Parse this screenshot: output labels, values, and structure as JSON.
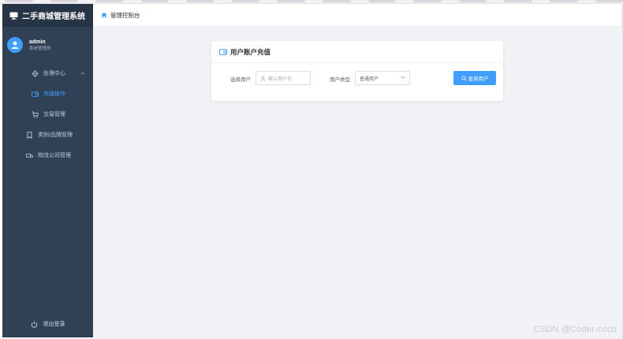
{
  "app": {
    "brand_title": "二手商城管理系统"
  },
  "user": {
    "name": "admin",
    "role": "系统管理员"
  },
  "sidebar": {
    "items": [
      {
        "label": "处理中心",
        "icon": "gear-icon"
      },
      {
        "label": "充值操作",
        "icon": "wallet-icon",
        "active": true
      },
      {
        "label": "交易管理",
        "icon": "cart-icon"
      },
      {
        "label": "类别/品牌管理",
        "icon": "bookmark-icon"
      },
      {
        "label": "物流公司管理",
        "icon": "truck-icon"
      }
    ],
    "logout_label": "退出登录"
  },
  "header": {
    "breadcrumb": "管理控制台"
  },
  "recharge_card": {
    "title": "用户账户充值",
    "select_user_label": "选择用户",
    "user_input_placeholder": "输入用户名",
    "user_type_label": "用户类型",
    "user_type_value": "普通用户",
    "query_button_label": "查询用户"
  },
  "watermark": "CSDN @Coder-coco",
  "colors": {
    "sidebar_bg": "#304156",
    "brand_bg": "#263445",
    "accent": "#409eff",
    "content_bg": "#f0f2f5"
  }
}
